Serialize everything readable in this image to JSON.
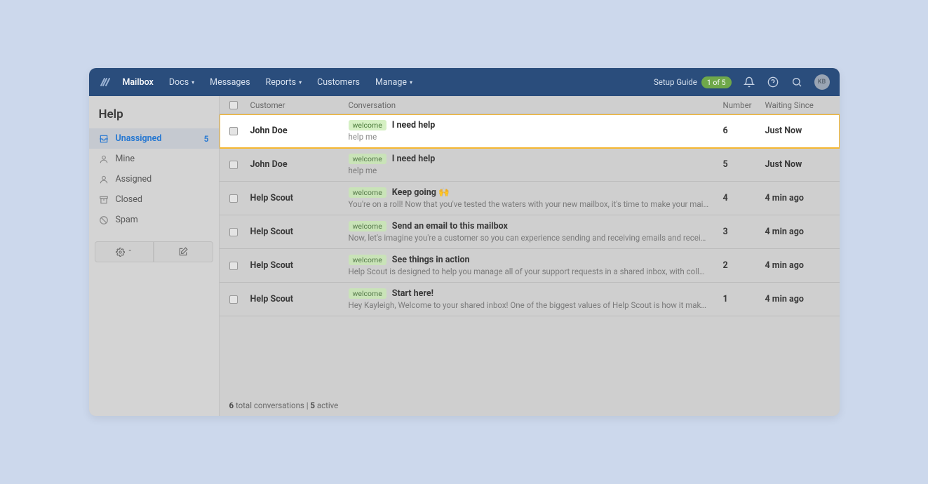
{
  "nav": {
    "items": [
      "Mailbox",
      "Docs",
      "Messages",
      "Reports",
      "Customers",
      "Manage"
    ],
    "setup_label": "Setup Guide",
    "setup_progress": "1 of 5",
    "avatar_initials": "KB"
  },
  "sidebar": {
    "title": "Help",
    "items": [
      {
        "label": "Unassigned",
        "count": "5",
        "icon": "inbox"
      },
      {
        "label": "Mine",
        "icon": "user"
      },
      {
        "label": "Assigned",
        "icon": "user-outline"
      },
      {
        "label": "Closed",
        "icon": "archive"
      },
      {
        "label": "Spam",
        "icon": "blocked"
      }
    ]
  },
  "columns": {
    "customer": "Customer",
    "conversation": "Conversation",
    "number": "Number",
    "waiting": "Waiting Since"
  },
  "rows": [
    {
      "customer": "John Doe",
      "tag": "welcome",
      "subject": "I need help",
      "preview": "help me",
      "number": "6",
      "waiting": "Just Now",
      "highlight": true
    },
    {
      "customer": "John Doe",
      "tag": "welcome",
      "subject": "I need help",
      "preview": "help me",
      "number": "5",
      "waiting": "Just Now"
    },
    {
      "customer": "Help Scout",
      "tag": "welcome",
      "subject": "Keep going 🙌",
      "preview": "You're on a roll! Now that you've tested the waters with your new mailbox, it's time to make your mailbox feel like your o",
      "number": "4",
      "waiting": "4 min ago"
    },
    {
      "customer": "Help Scout",
      "tag": "welcome",
      "subject": "Send an email to this mailbox",
      "preview": "Now, let's imagine you're a customer so you can experience sending and receiving emails and receiving emails in your",
      "number": "3",
      "waiting": "4 min ago"
    },
    {
      "customer": "Help Scout",
      "tag": "welcome",
      "subject": "See things in action",
      "preview": "Help Scout is designed to help you manage all of your support requests in a shared inbox, with collaborative features s",
      "number": "2",
      "waiting": "4 min ago"
    },
    {
      "customer": "Help Scout",
      "tag": "welcome",
      "subject": "Start here!",
      "preview": "Hey Kayleigh, Welcome to your shared inbox! One of the biggest values of Help Scout is how it makes team collaborati",
      "number": "1",
      "waiting": "4 min ago"
    }
  ],
  "footer": {
    "total_count": "6",
    "total_label": " total conversations",
    "sep": "  |  ",
    "active_count": "5",
    "active_label": " active"
  }
}
